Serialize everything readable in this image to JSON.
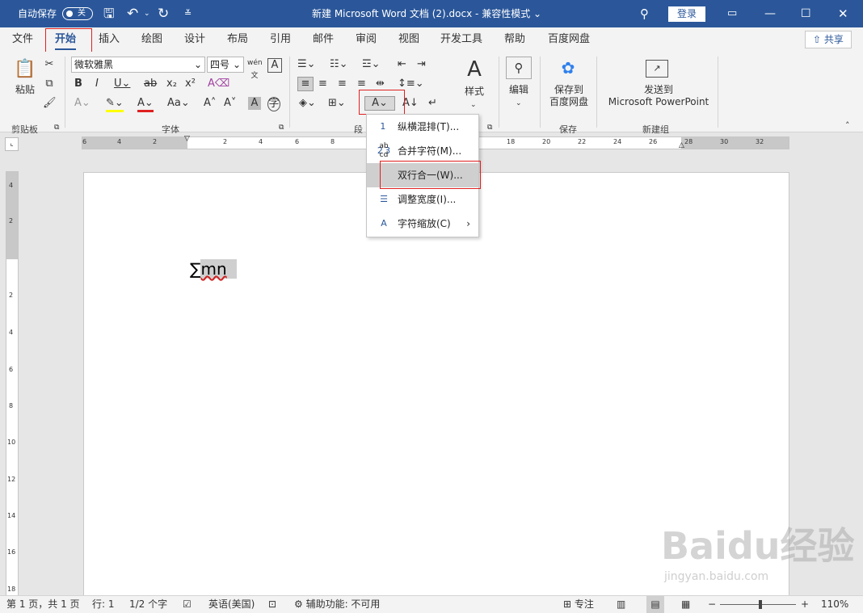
{
  "titlebar": {
    "autosave_label": "自动保存",
    "autosave_state": "关",
    "doc_title": "新建 Microsoft Word 文档 (2).docx",
    "separator": "-",
    "mode": "兼容性模式",
    "login": "登录"
  },
  "tabs": [
    "文件",
    "开始",
    "插入",
    "绘图",
    "设计",
    "布局",
    "引用",
    "邮件",
    "审阅",
    "视图",
    "开发工具",
    "帮助",
    "百度网盘"
  ],
  "share_label": "共享",
  "ribbon": {
    "clipboard": {
      "paste": "粘贴",
      "group": "剪贴板"
    },
    "font": {
      "name": "微软雅黑",
      "size": "四号",
      "group": "字体"
    },
    "paragraph": {
      "group": "段"
    },
    "styles": {
      "label": "样式"
    },
    "editing": {
      "label": "编辑"
    },
    "baidu": {
      "line1": "保存到",
      "line2": "百度网盘",
      "group": "保存"
    },
    "ppt": {
      "line1": "发送到",
      "line2": "Microsoft PowerPoint",
      "group": "新建组"
    }
  },
  "ruler": {
    "h_ticks": [
      "6",
      "4",
      "2",
      "2",
      "4",
      "6",
      "8",
      "18",
      "20",
      "22",
      "24",
      "26",
      "28",
      "30",
      "32"
    ],
    "v_ticks": [
      "4",
      "2",
      "2",
      "4",
      "6",
      "8",
      "10",
      "12",
      "14",
      "16",
      "18"
    ]
  },
  "document": {
    "sigma": "∑",
    "text": "mn"
  },
  "dropdown": {
    "items": [
      {
        "icon": "1 2 3",
        "label": "纵横混排(T)..."
      },
      {
        "icon": "ab cd",
        "label": "合并字符(M)..."
      },
      {
        "icon": "",
        "label": "双行合一(W)..."
      },
      {
        "icon": "☰",
        "label": "调整宽度(I)..."
      },
      {
        "icon": "A",
        "label": "字符缩放(C)"
      }
    ]
  },
  "status": {
    "page": "第 1 页，共 1 页",
    "line": "行: 1",
    "words": "1/2 个字",
    "lang": "英语(美国)",
    "access": "辅助功能: 不可用",
    "focus": "专注",
    "zoom": "110%"
  },
  "watermark": {
    "text": "Baidu经验",
    "url": "jingyan.baidu.com"
  }
}
